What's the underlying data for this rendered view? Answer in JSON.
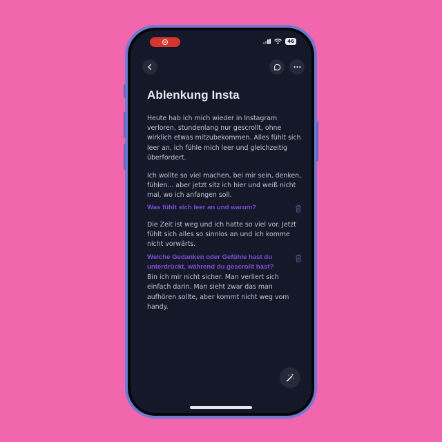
{
  "status_bar": {
    "battery": "46",
    "recording_color": "#d6352f"
  },
  "toolbar": {
    "back_icon": "chevron-left-icon",
    "comment_icon": "speech-bubble-icon",
    "more_icon": "ellipsis-icon"
  },
  "entry": {
    "title": "Ablenkung Insta",
    "paragraph_1": "Heute hab ich mich wieder in Instagram verloren, stundenlang nur gescrollt, ohne wirklich etwas mitzubekommen. Alles fühlt sich leer an, ich fühle mich leer und gleichzeitig überfordert.",
    "paragraph_2": "Ich wollte so viel machen, bei mir sein, denken, fühlen... aber jetzt sitz ich hier und weiß nicht mal, wo ich anfangen soll.",
    "prompts": [
      {
        "question": "Was fühlt sich leer an und warum?",
        "answer": "Die Zeit ist weg und ich hatte so viel vor. Jetzt fühlt sich alles so sinnlos an und ich komme nicht vorwärts."
      },
      {
        "question": "Welche Gedanken oder Gefühle hast du unterdrückt, während du gescrollt hast?",
        "answer": "Bin ich mir nicht sicher. Man verliert sich einfach darin. Man sieht zwar das man aufhören sollte, aber kommt nicht weg vom handy."
      }
    ]
  },
  "fab": {
    "icon": "magic-wand-icon"
  },
  "colors": {
    "page_background": "#f266ad",
    "screen_background": "#141828",
    "accent_purple": "#7c4fd6"
  }
}
